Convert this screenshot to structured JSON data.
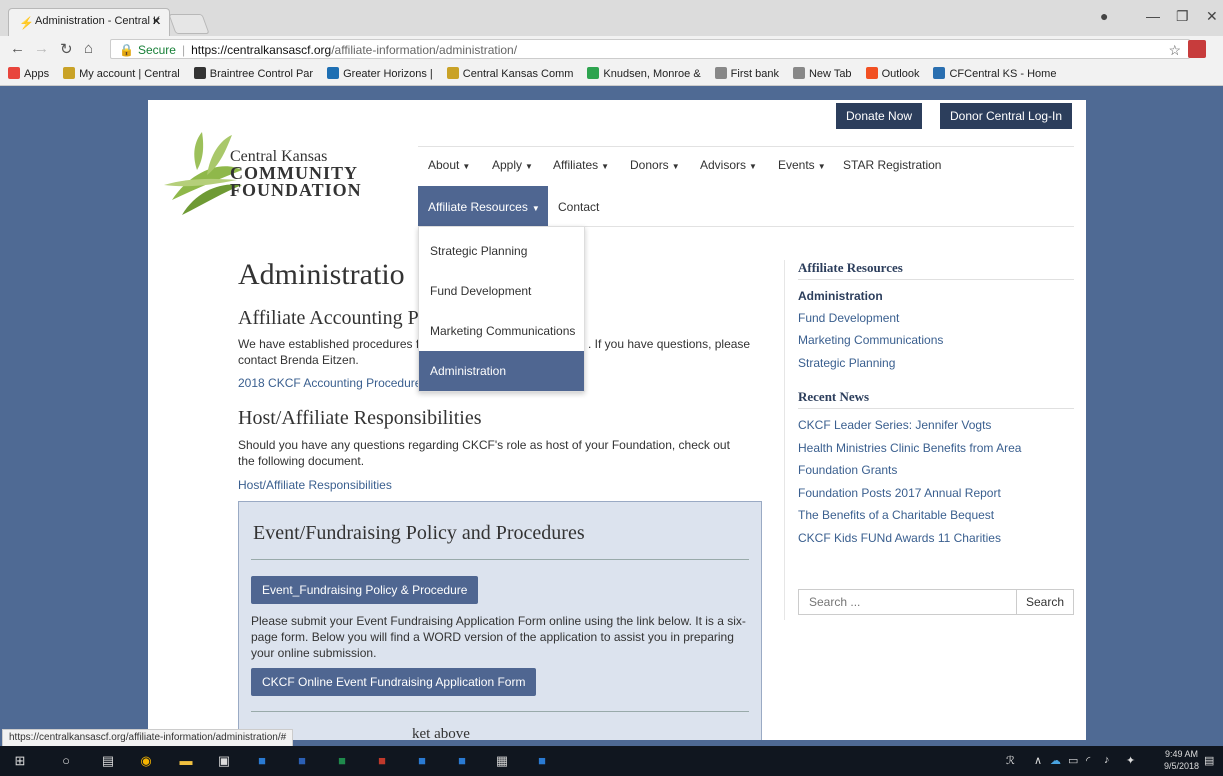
{
  "browser": {
    "tab_title": "Administration - Central K",
    "url_secure": "Secure",
    "url_host": "https://centralkansascf.org",
    "url_path": "/affiliate-information/administration/",
    "bookmarks": [
      {
        "label": "Apps",
        "color": "#e8453c"
      },
      {
        "label": "My account | Central",
        "color": "#c9a227"
      },
      {
        "label": "Braintree Control Par",
        "color": "#333333"
      },
      {
        "label": "Greater Horizons |",
        "color": "#1e6fb3"
      },
      {
        "label": "Central Kansas Comm",
        "color": "#c9a227"
      },
      {
        "label": "Knudsen, Monroe &",
        "color": "#2ea44f"
      },
      {
        "label": "First bank",
        "color": "#888888"
      },
      {
        "label": "New Tab",
        "color": "#888888"
      },
      {
        "label": "Outlook",
        "color": "#f25022"
      },
      {
        "label": "CFCentral KS - Home",
        "color": "#2a6fb0"
      }
    ]
  },
  "header": {
    "donate": "Donate Now",
    "login": "Donor Central Log-In",
    "logo_line1": "Central Kansas",
    "logo_line2": "Community",
    "logo_line3": "Foundation"
  },
  "nav": {
    "about": "About",
    "apply": "Apply",
    "affiliates": "Affiliates",
    "donors": "Donors",
    "advisors": "Advisors",
    "events": "Events",
    "star": "STAR Registration",
    "affiliate_resources": "Affiliate Resources",
    "contact": "Contact"
  },
  "dropdown": [
    "Strategic Planning",
    "Fund Development",
    "Marketing Communications",
    "Administration"
  ],
  "main": {
    "title": "Administratio",
    "accounting_heading": "Affiliate Accounting P",
    "accounting_text_a": "We have established procedures fo",
    "accounting_text_b": ". If you have questions, please",
    "accounting_text_c": "contact Brenda Eitzen.",
    "accounting_link": "2018 CKCF Accounting Procedures",
    "host_heading": "Host/Affiliate Responsibilities",
    "host_text": "Should you have any questions regarding CKCF's role as host of your Foundation, check out the following document.",
    "host_link": "Host/Affiliate Responsibilities",
    "event_heading": "Event/Fundraising Policy and Procedures",
    "event_btn": "Event_Fundraising Policy & Procedure",
    "event_text": "Please submit your Event Fundraising Application Form online using the link below. It is a six-page form. Below you will find a WORD version of the application to assist you in preparing your online submission.",
    "event_form_btn": "CKCF Online Event Fundraising Application Form",
    "event_tail": "ket above"
  },
  "sidebar": {
    "resources_heading": "Affiliate Resources",
    "resources": [
      "Administration",
      "Fund Development",
      "Marketing Communications",
      "Strategic Planning"
    ],
    "news_heading": "Recent News",
    "news": [
      "CKCF Leader Series: Jennifer Vogts",
      "Health Ministries Clinic Benefits from Area",
      "Foundation Grants",
      "Foundation Posts 2017 Annual Report",
      "The Benefits of a Charitable Bequest",
      "CKCF Kids FUNd Awards 11 Charities"
    ],
    "search_placeholder": "Search ...",
    "search_button": "Search"
  },
  "status_url": "https://centralkansascf.org/affiliate-information/administration/#",
  "taskbar": {
    "time": "9:49 AM",
    "date": "9/5/2018"
  }
}
